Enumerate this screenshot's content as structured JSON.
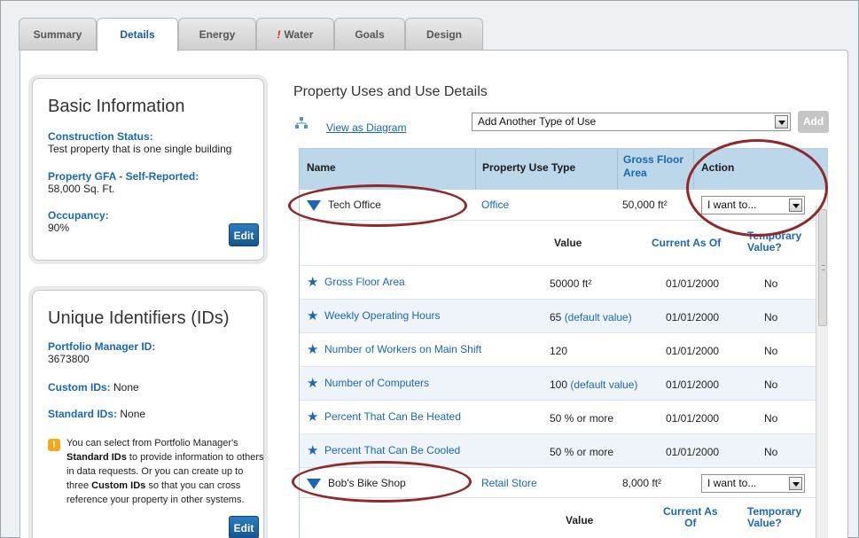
{
  "tabs": [
    {
      "label": "Summary",
      "active": false
    },
    {
      "label": "Details",
      "active": true
    },
    {
      "label": "Energy",
      "active": false
    },
    {
      "label": "Water",
      "active": false,
      "alert": "!"
    },
    {
      "label": "Goals",
      "active": false
    },
    {
      "label": "Design",
      "active": false
    }
  ],
  "basic_info": {
    "title": "Basic Information",
    "construction_label": "Construction Status:",
    "construction_value": "Test property that is one single building",
    "gfa_label": "Property GFA - Self-Reported:",
    "gfa_value": "58,000 Sq. Ft.",
    "occupancy_label": "Occupancy:",
    "occupancy_value": "90%",
    "edit_label": "Edit"
  },
  "ids": {
    "title": "Unique Identifiers (IDs)",
    "pm_label": "Portfolio Manager ID:",
    "pm_value": "3673800",
    "custom_label": "Custom IDs:",
    "custom_value": " None",
    "standard_label": "Standard IDs:",
    "standard_value": " None",
    "tip_icon": "!",
    "tip_1": "You can select from Portfolio Manager's",
    "tip_2b": "Standard IDs",
    "tip_2": " to provide information to others",
    "tip_3": "in data requests. Or you can create up to",
    "tip_4a": "three ",
    "tip_4b": "Custom IDs",
    "tip_4": " so that you can cross",
    "tip_5": "reference your property in other systems.",
    "edit_label": "Edit"
  },
  "uses": {
    "title": "Property Uses and Use Details",
    "diagram_link": "View as Diagram",
    "add_select_value": "Add Another Type of Use",
    "add_button": "Add",
    "headers": {
      "name": "Name",
      "type": "Property Use Type",
      "gfa": "Gross Floor Area",
      "action": "Action"
    },
    "sub_headers": {
      "value": "Value",
      "current_as_of": "Current As Of",
      "temporary": "Temporary Value?"
    },
    "properties": [
      {
        "name": "Tech Office",
        "type": "Office",
        "gfa": "50,000 ft²",
        "action": "I want to...",
        "details": [
          {
            "label": "Gross Floor Area",
            "value": "50000 ft²",
            "default_note": "",
            "date": "01/01/2000",
            "temp": "No"
          },
          {
            "label": "Weekly Operating Hours",
            "value": "65 ",
            "default_note": "(default value)",
            "date": "01/01/2000",
            "temp": "No"
          },
          {
            "label": "Number of Workers on Main Shift",
            "value": "120",
            "default_note": "",
            "date": "01/01/2000",
            "temp": "No"
          },
          {
            "label": "Number of Computers",
            "value": "100 ",
            "default_note": "(default value)",
            "date": "01/01/2000",
            "temp": "No"
          },
          {
            "label": "Percent That Can Be Heated",
            "value": "50 % or more",
            "default_note": "",
            "date": "01/01/2000",
            "temp": "No"
          },
          {
            "label": "Percent That Can Be Cooled",
            "value": "50 % or more",
            "default_note": "",
            "date": "01/01/2000",
            "temp": "No"
          }
        ]
      },
      {
        "name": "Bob's Bike Shop",
        "type": "Retail Store",
        "gfa": "8,000 ft²",
        "action": "I want to..."
      }
    ],
    "sub_headers_2": {
      "value": "Value",
      "current_as_of_1": "Current As",
      "current_as_of_2": "Of",
      "temporary_1": "Temporary",
      "temporary_2": "Value?"
    }
  },
  "colors": {
    "accent": "#1a67b5",
    "annotation": "#8e2a2a",
    "header_bg": "#bcd6ea"
  },
  "icons": [
    "diagram-icon",
    "expand-triangle-icon",
    "star-icon",
    "info-icon",
    "dropdown-arrow-icon"
  ]
}
